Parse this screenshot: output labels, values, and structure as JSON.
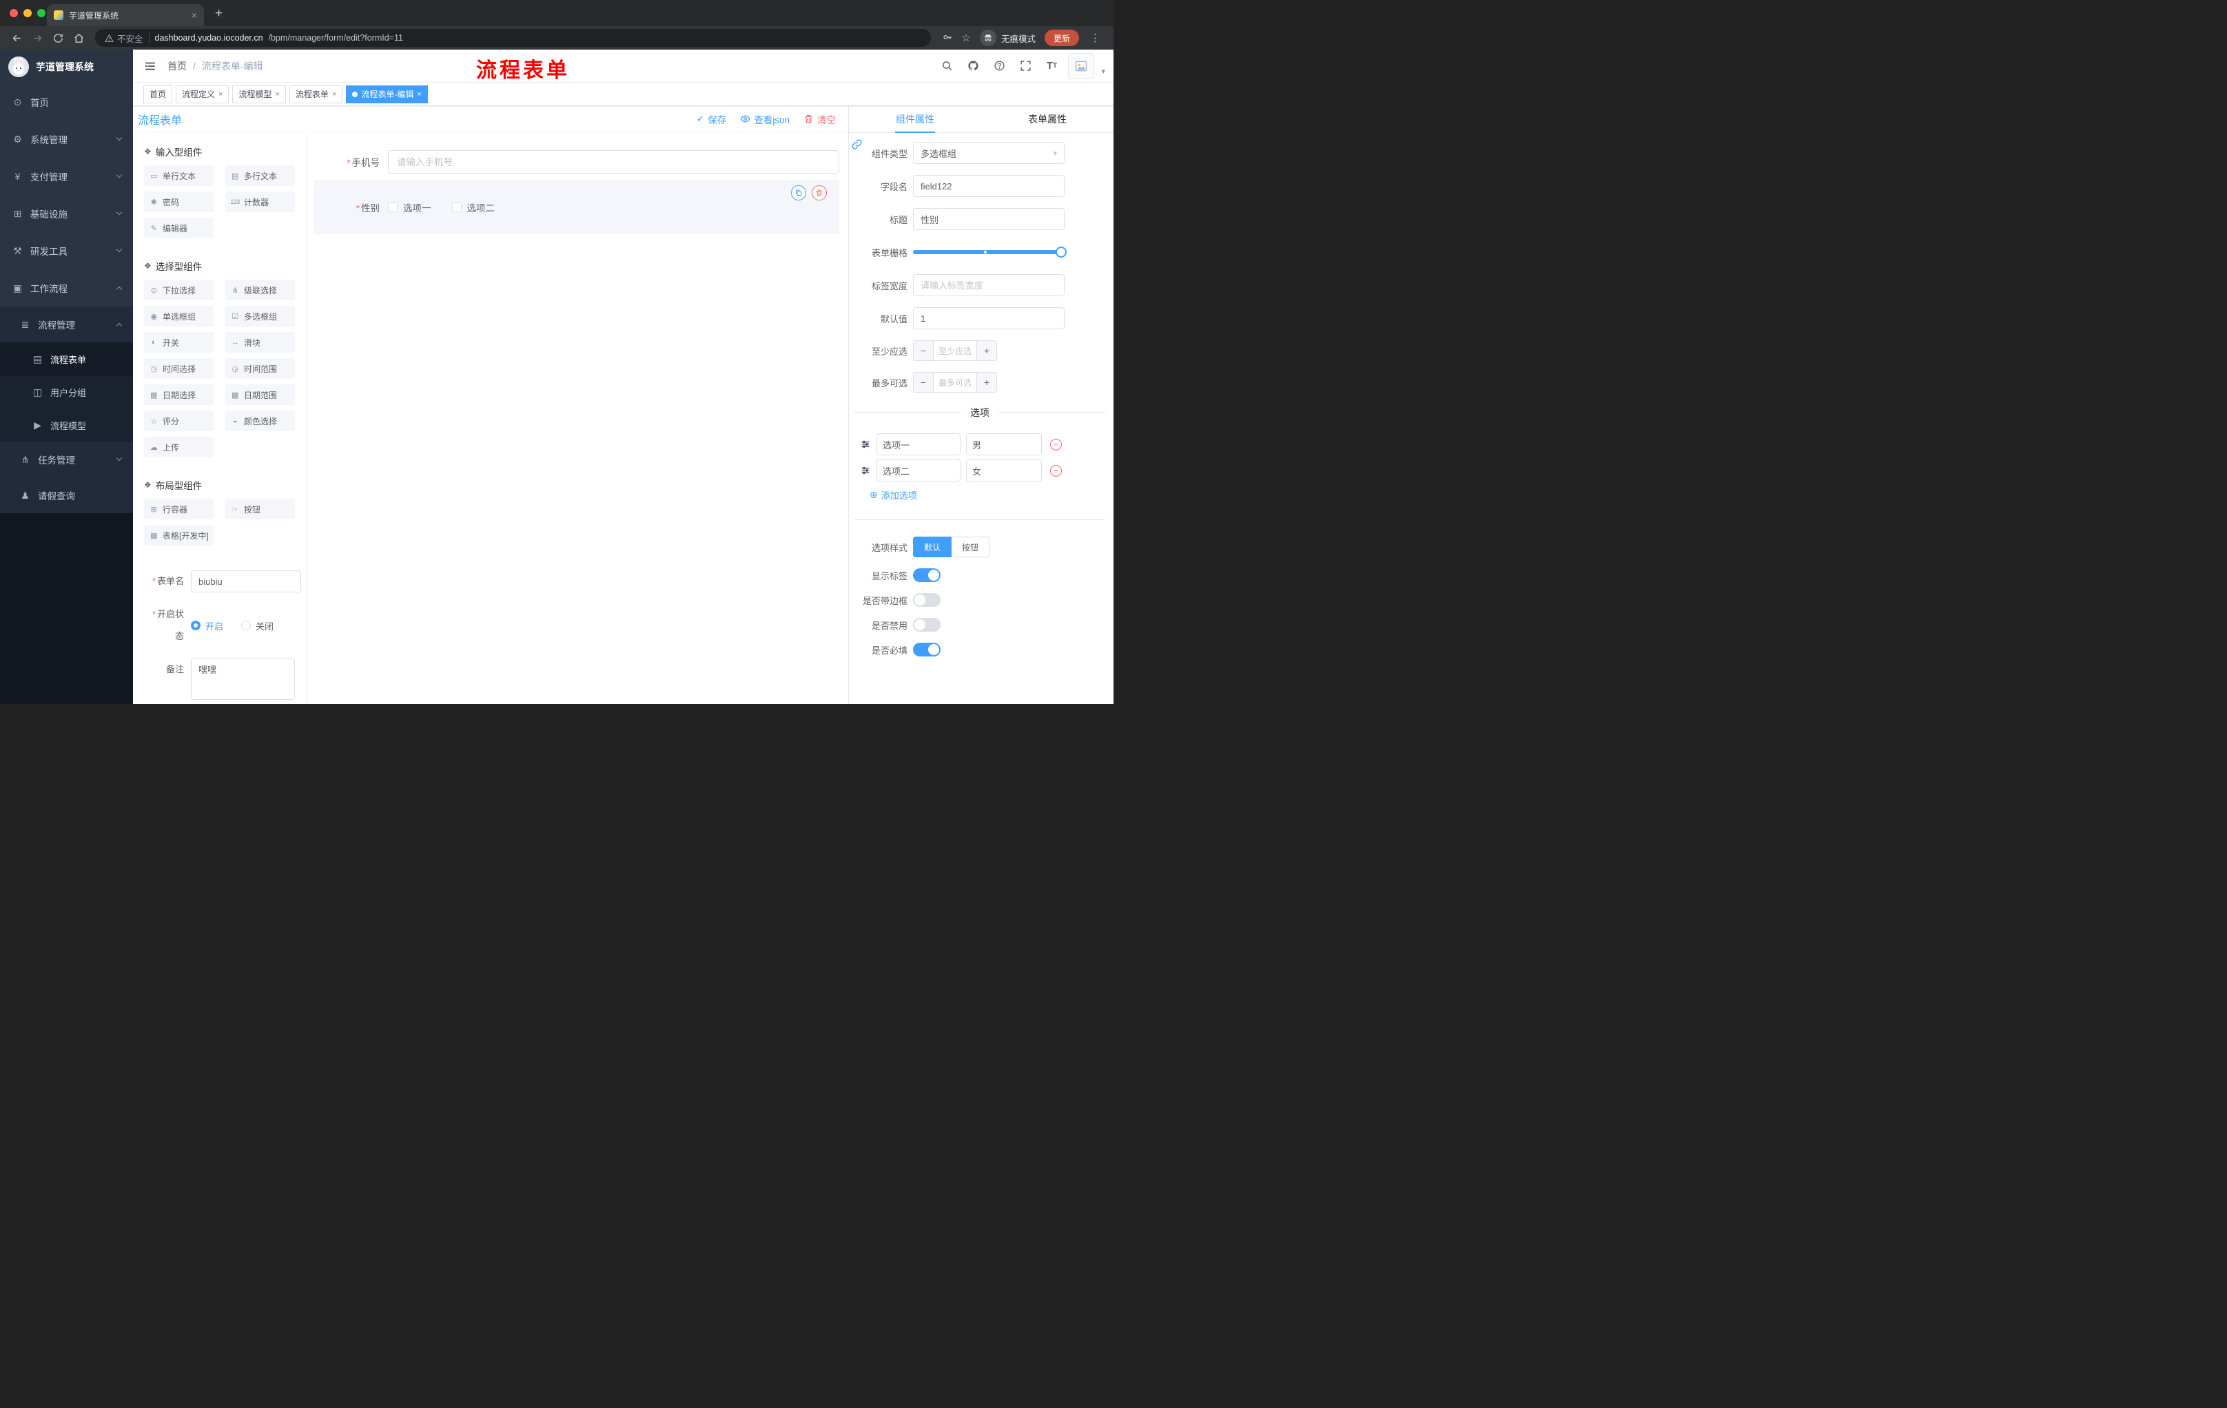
{
  "colors": {
    "primary": "#409eff",
    "danger": "#f56c6c",
    "sidebar_bg": "#2a3443",
    "annotation": "#ff0000"
  },
  "glyphs": {
    "asterisk": "*",
    "check": "✓",
    "close": "×",
    "plus": "+",
    "minus": "−",
    "plus_circle": "⊕",
    "dots": "⋮",
    "caret_down": "▾",
    "star": "☆"
  },
  "browser": {
    "tab_title": "芋道管理系统",
    "security_label": "不安全",
    "url_domain": "dashboard.yudao.iocoder.cn",
    "url_path": "/bpm/manager/form/edit?formId=11",
    "incognito_label": "无痕模式",
    "update_label": "更新"
  },
  "sidebar": {
    "logo_title": "芋道管理系统",
    "menu": [
      {
        "label": "首页",
        "icon": "⊙"
      },
      {
        "label": "系统管理",
        "icon": "⚙"
      },
      {
        "label": "支付管理",
        "icon": "¥"
      },
      {
        "label": "基础设施",
        "icon": "⊞"
      },
      {
        "label": "研发工具",
        "icon": "⚒"
      },
      {
        "label": "工作流程",
        "icon": "▣"
      },
      {
        "label": "流程管理",
        "icon": "≣"
      },
      {
        "label": "流程表单",
        "icon": "▤"
      },
      {
        "label": "用户分组",
        "icon": "◫"
      },
      {
        "label": "流程模型",
        "icon": "▶"
      },
      {
        "label": "任务管理",
        "icon": "⋔"
      },
      {
        "label": "请假查询",
        "icon": "♟"
      }
    ]
  },
  "navbar": {
    "breadcrumb_home": "首页",
    "breadcrumb_sep": "/",
    "breadcrumb_current": "流程表单-编辑",
    "annotation": "流程表单"
  },
  "tags": [
    {
      "label": "首页"
    },
    {
      "label": "流程定义"
    },
    {
      "label": "流程模型"
    },
    {
      "label": "流程表单"
    },
    {
      "label": "流程表单-编辑"
    }
  ],
  "designer": {
    "title": "流程表单",
    "actions": {
      "save": "保存",
      "view_json": "查看json",
      "clear": "清空"
    },
    "groups": [
      {
        "title": "输入型组件",
        "icon": "❖",
        "items": [
          {
            "label": "单行文本",
            "icon": "▭"
          },
          {
            "label": "多行文本",
            "icon": "▤"
          },
          {
            "label": "密码",
            "icon": "✱"
          },
          {
            "label": "计数器",
            "icon": "123"
          },
          {
            "label": "编辑器",
            "icon": "✎"
          }
        ]
      },
      {
        "title": "选择型组件",
        "icon": "❖",
        "items": [
          {
            "label": "下拉选择",
            "icon": "⊙"
          },
          {
            "label": "级联选择",
            "icon": "⋔"
          },
          {
            "label": "单选框组",
            "icon": "◉"
          },
          {
            "label": "多选框组",
            "icon": "☑"
          },
          {
            "label": "开关",
            "icon": "◐"
          },
          {
            "label": "滑块",
            "icon": "↔"
          },
          {
            "label": "时间选择",
            "icon": "◷"
          },
          {
            "label": "时间范围",
            "icon": "◶"
          },
          {
            "label": "日期选择",
            "icon": "▦"
          },
          {
            "label": "日期范围",
            "icon": "▩"
          },
          {
            "label": "评分",
            "icon": "☆"
          },
          {
            "label": "颜色选择",
            "icon": "◒"
          },
          {
            "label": "上传",
            "icon": "☁"
          }
        ]
      },
      {
        "title": "布局型组件",
        "icon": "❖",
        "items": [
          {
            "label": "行容器",
            "icon": "⊞"
          },
          {
            "label": "按钮",
            "icon": "☞"
          },
          {
            "label": "表格[开发中]",
            "icon": "▦"
          }
        ]
      }
    ],
    "meta": {
      "form_name_label": "表单名",
      "form_name_value": "biubiu",
      "status_label": "开启状态",
      "status_on": "开启",
      "status_off": "关闭",
      "remark_label": "备注",
      "remark_value": "嘿嘿"
    }
  },
  "canvas": {
    "phone_label": "手机号",
    "phone_placeholder": "请输入手机号",
    "gender_label": "性别",
    "gender_options": [
      "选项一",
      "选项二"
    ]
  },
  "props": {
    "tab_component": "组件属性",
    "tab_form": "表单属性",
    "rows": {
      "component_type_label": "组件类型",
      "component_type_value": "多选框组",
      "field_name_label": "字段名",
      "field_name_value": "field122",
      "title_label": "标题",
      "title_value": "性别",
      "grid_label": "表单栅格",
      "label_width_label": "标签宽度",
      "label_width_placeholder": "请输入标签宽度",
      "default_label": "默认值",
      "default_value": "1",
      "min_label": "至少应选",
      "min_placeholder": "至少应选",
      "max_label": "最多可选",
      "max_placeholder": "最多可选"
    },
    "options": {
      "divider_title": "选项",
      "rows": [
        {
          "label": "选项一",
          "value": "男"
        },
        {
          "label": "选项二",
          "value": "女"
        }
      ],
      "add_label": "添加选项"
    },
    "style": {
      "label": "选项样式",
      "default": "默认",
      "button": "按钮"
    },
    "switches": {
      "show_label": "显示标签",
      "border": "是否带边框",
      "disabled": "是否禁用",
      "required": "是否必填"
    }
  }
}
